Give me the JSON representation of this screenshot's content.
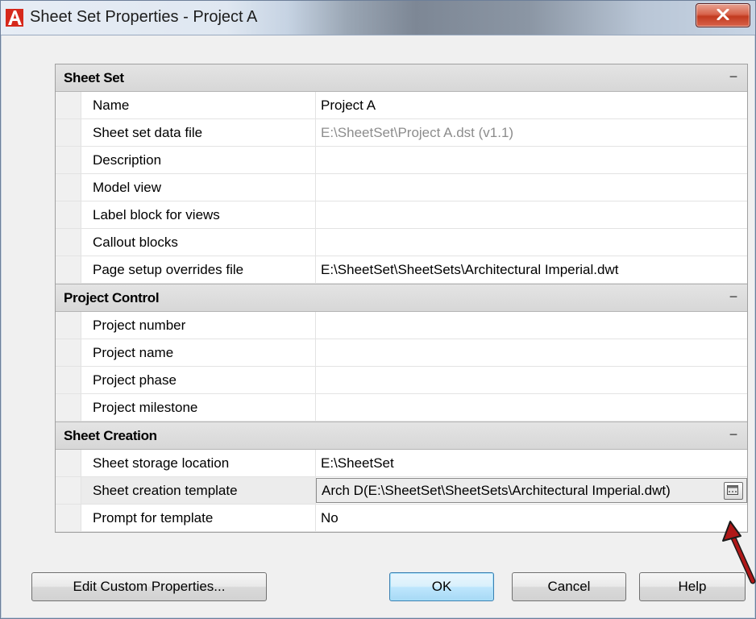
{
  "window": {
    "title": "Sheet Set Properties - Project A",
    "close_label": "X"
  },
  "categories": [
    {
      "title": "Sheet Set",
      "toggle": "−",
      "rows": [
        {
          "label": "Name",
          "value": "Project A"
        },
        {
          "label": "Sheet set data file",
          "value": "E:\\SheetSet\\Project A.dst (v1.1)"
        },
        {
          "label": "Description",
          "value": ""
        },
        {
          "label": "Model view",
          "value": ""
        },
        {
          "label": "Label block for views",
          "value": ""
        },
        {
          "label": "Callout blocks",
          "value": ""
        },
        {
          "label": "Page setup overrides file",
          "value": "E:\\SheetSet\\SheetSets\\Architectural Imperial.dwt"
        }
      ]
    },
    {
      "title": "Project Control",
      "toggle": "−",
      "rows": [
        {
          "label": "Project number",
          "value": ""
        },
        {
          "label": "Project name",
          "value": ""
        },
        {
          "label": "Project phase",
          "value": ""
        },
        {
          "label": "Project milestone",
          "value": ""
        }
      ]
    },
    {
      "title": "Sheet Creation",
      "toggle": "−",
      "rows": [
        {
          "label": "Sheet storage location",
          "value": "E:\\SheetSet"
        },
        {
          "label": "Sheet creation template",
          "value": "Arch D(E:\\SheetSet\\SheetSets\\Architectural Imperial.dwt)"
        },
        {
          "label": "Prompt for template",
          "value": "No"
        }
      ]
    }
  ],
  "buttons": {
    "edit_custom": "Edit Custom Properties...",
    "ok": "OK",
    "cancel": "Cancel",
    "help": "Help"
  },
  "colors": {
    "app_icon_red": "#d6291c",
    "arrow_red": "#b01818",
    "readonly_text": "#8c8c8c"
  }
}
